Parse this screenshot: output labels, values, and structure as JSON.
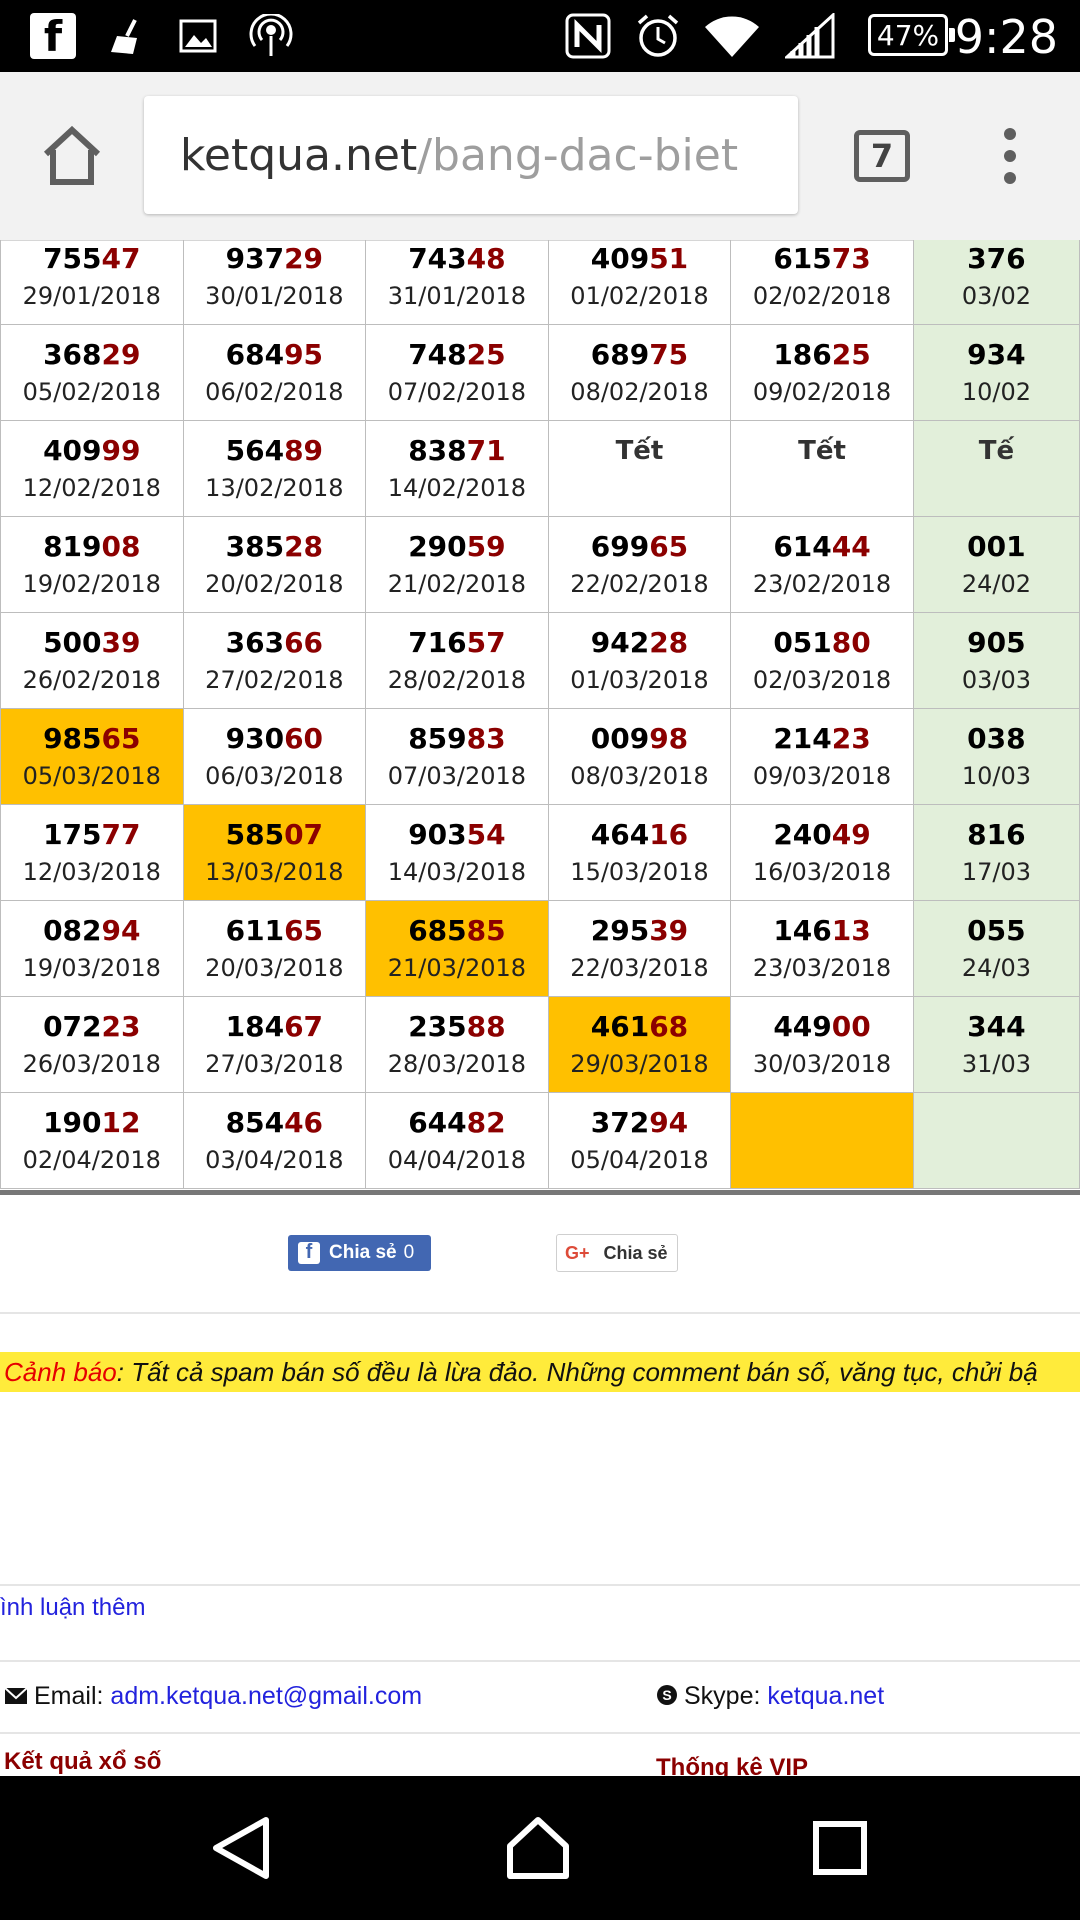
{
  "status_bar": {
    "time": "9:28",
    "battery": "47%",
    "icons": [
      "facebook-icon",
      "broom-icon",
      "image-icon",
      "hotspot-icon",
      "nfc-icon",
      "alarm-icon",
      "wifi-icon",
      "signal-icon",
      "battery-icon"
    ]
  },
  "browser": {
    "url_domain": "ketqua.net",
    "url_path": "/bang-dac-biet",
    "tab_count": "7"
  },
  "table": {
    "rows": [
      [
        {
          "p": "755",
          "t": "47",
          "d": "29/01/2018"
        },
        {
          "p": "937",
          "t": "29",
          "d": "30/01/2018"
        },
        {
          "p": "743",
          "t": "48",
          "d": "31/01/2018"
        },
        {
          "p": "409",
          "t": "51",
          "d": "01/02/2018"
        },
        {
          "p": "615",
          "t": "73",
          "d": "02/02/2018"
        },
        {
          "p": "376",
          "t": "",
          "d": "03/02",
          "green": true
        }
      ],
      [
        {
          "p": "368",
          "t": "29",
          "d": "05/02/2018"
        },
        {
          "p": "684",
          "t": "95",
          "d": "06/02/2018"
        },
        {
          "p": "748",
          "t": "25",
          "d": "07/02/2018"
        },
        {
          "p": "689",
          "t": "75",
          "d": "08/02/2018"
        },
        {
          "p": "186",
          "t": "25",
          "d": "09/02/2018"
        },
        {
          "p": "934",
          "t": "",
          "d": "10/02",
          "green": true
        }
      ],
      [
        {
          "p": "409",
          "t": "99",
          "d": "12/02/2018"
        },
        {
          "p": "564",
          "t": "89",
          "d": "13/02/2018"
        },
        {
          "p": "838",
          "t": "71",
          "d": "14/02/2018"
        },
        {
          "tet": "Tết"
        },
        {
          "tet": "Tết"
        },
        {
          "tet": "Tế",
          "green": true
        }
      ],
      [
        {
          "p": "819",
          "t": "08",
          "d": "19/02/2018"
        },
        {
          "p": "385",
          "t": "28",
          "d": "20/02/2018"
        },
        {
          "p": "290",
          "t": "59",
          "d": "21/02/2018"
        },
        {
          "p": "699",
          "t": "65",
          "d": "22/02/2018"
        },
        {
          "p": "614",
          "t": "44",
          "d": "23/02/2018"
        },
        {
          "p": "001",
          "t": "",
          "d": "24/02",
          "green": true
        }
      ],
      [
        {
          "p": "500",
          "t": "39",
          "d": "26/02/2018"
        },
        {
          "p": "363",
          "t": "66",
          "d": "27/02/2018"
        },
        {
          "p": "716",
          "t": "57",
          "d": "28/02/2018"
        },
        {
          "p": "942",
          "t": "28",
          "d": "01/03/2018"
        },
        {
          "p": "051",
          "t": "80",
          "d": "02/03/2018"
        },
        {
          "p": "905",
          "t": "",
          "d": "03/03",
          "green": true
        }
      ],
      [
        {
          "p": "985",
          "t": "65",
          "d": "05/03/2018",
          "gold": true
        },
        {
          "p": "930",
          "t": "60",
          "d": "06/03/2018"
        },
        {
          "p": "859",
          "t": "83",
          "d": "07/03/2018"
        },
        {
          "p": "009",
          "t": "98",
          "d": "08/03/2018"
        },
        {
          "p": "214",
          "t": "23",
          "d": "09/03/2018"
        },
        {
          "p": "038",
          "t": "",
          "d": "10/03",
          "green": true
        }
      ],
      [
        {
          "p": "175",
          "t": "77",
          "d": "12/03/2018"
        },
        {
          "p": "585",
          "t": "07",
          "d": "13/03/2018",
          "gold": true
        },
        {
          "p": "903",
          "t": "54",
          "d": "14/03/2018"
        },
        {
          "p": "464",
          "t": "16",
          "d": "15/03/2018"
        },
        {
          "p": "240",
          "t": "49",
          "d": "16/03/2018"
        },
        {
          "p": "816",
          "t": "",
          "d": "17/03",
          "green": true
        }
      ],
      [
        {
          "p": "082",
          "t": "94",
          "d": "19/03/2018"
        },
        {
          "p": "611",
          "t": "65",
          "d": "20/03/2018"
        },
        {
          "p": "685",
          "t": "85",
          "d": "21/03/2018",
          "gold": true
        },
        {
          "p": "295",
          "t": "39",
          "d": "22/03/2018"
        },
        {
          "p": "146",
          "t": "13",
          "d": "23/03/2018"
        },
        {
          "p": "055",
          "t": "",
          "d": "24/03",
          "green": true
        }
      ],
      [
        {
          "p": "072",
          "t": "23",
          "d": "26/03/2018"
        },
        {
          "p": "184",
          "t": "67",
          "d": "27/03/2018"
        },
        {
          "p": "235",
          "t": "88",
          "d": "28/03/2018"
        },
        {
          "p": "461",
          "t": "68",
          "d": "29/03/2018",
          "gold": true
        },
        {
          "p": "449",
          "t": "00",
          "d": "30/03/2018"
        },
        {
          "p": "344",
          "t": "",
          "d": "31/03",
          "green": true
        }
      ],
      [
        {
          "p": "190",
          "t": "12",
          "d": "02/04/2018"
        },
        {
          "p": "854",
          "t": "46",
          "d": "03/04/2018"
        },
        {
          "p": "644",
          "t": "82",
          "d": "04/04/2018"
        },
        {
          "p": "372",
          "t": "94",
          "d": "05/04/2018"
        },
        {
          "empty": true,
          "gold": true
        },
        {
          "empty": true,
          "green": true
        }
      ]
    ]
  },
  "share": {
    "fb_label": "Chia sẻ",
    "fb_count": "0",
    "gplus_label": "Chia sẻ"
  },
  "warning": {
    "label": "Cảnh báo",
    "text": ": Tất cả spam bán số đều là lừa đảo. Những comment bán số, văng tục, chửi bậ"
  },
  "comments": {
    "more_link": "ình luận thêm"
  },
  "contact": {
    "email_label": "Email:",
    "email_value": "adm.ketqua.net@gmail.com",
    "skype_label": "Skype:",
    "skype_value": "ketqua.net"
  },
  "footer": {
    "results_link": "Kết quả xổ số",
    "vip_link": "Thống kê VIP"
  },
  "colors": {
    "highlight": "#ffc000",
    "weekend_col": "#e2efda",
    "tail_digits": "#8b0000",
    "warning_bg": "#ffeb3b",
    "link": "#2222dd"
  }
}
